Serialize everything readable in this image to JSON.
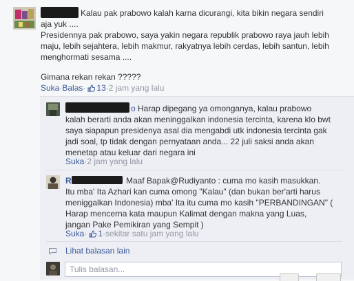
{
  "main_comment": {
    "lines": [
      "Kalau pak prabowo kalah karna dicurangi, kita bikin negara sendiri",
      "aja yuk ....",
      "Presidennya pak prabowo, saya yakin negara republik prabowo raya jauh lebih",
      "maju, lebih sejahtera, lebih makmur, rakyatnya lebih cerdas, lebih santun, lebih",
      "menghormati sesama ....",
      "Gimana rekan rekan ?????"
    ],
    "actions": {
      "like": "Suka",
      "dot1": " · ",
      "reply": "Balas",
      "dot2": " · ",
      "like_count": "13",
      "dot3": " · ",
      "time": "2 jam yang lalu"
    }
  },
  "reply1": {
    "name_suffix": "o",
    "lines": [
      "Harap dipegang ya omonganya, kalau prabowo",
      "kalah berarti anda akan meninggalkan indonesia tercinta, karena klo bwt",
      "saya siapapun presidenya asal dia mengabdi utk indonesia tercinta gak",
      "jadi soal, tp tidak dengan pernyataan anda... 22 juli saksi anda akan",
      "menetap atau keluar dari negara ini"
    ],
    "actions": {
      "like": "Suka",
      "dot1": " · ",
      "time": "2 jam yang lalu"
    }
  },
  "reply2": {
    "name_prefix": "R",
    "lines": [
      "Maaf Bapak@Rudiyanto : cuma mo kasih masukkan.",
      "Itu mba' Ita Azhari kan cuma omong \"Kalau\" (dan bukan ber'arti harus",
      "meniggalkan Indonesia) mba' Ita itu cuma mo kasih \"PERBANDINGAN\" (",
      "Harap mencerna kata maupun Kalimat dengan makna yang Luas,",
      "jangan Pake Pemikiran yang Sempit )"
    ],
    "actions": {
      "like": "Suka",
      "dot1": " · ",
      "like_count": "1",
      "dot2": " · ",
      "time": "sekitar satu jam yang lalu"
    }
  },
  "more_replies": {
    "label": "Lihat balasan lain"
  },
  "reply_input": {
    "placeholder": "Tulis balasan..."
  },
  "colors": {
    "link": "#3b5998",
    "muted": "#9197a3",
    "panel": "#edeff4",
    "background": "#f6f7f9"
  }
}
